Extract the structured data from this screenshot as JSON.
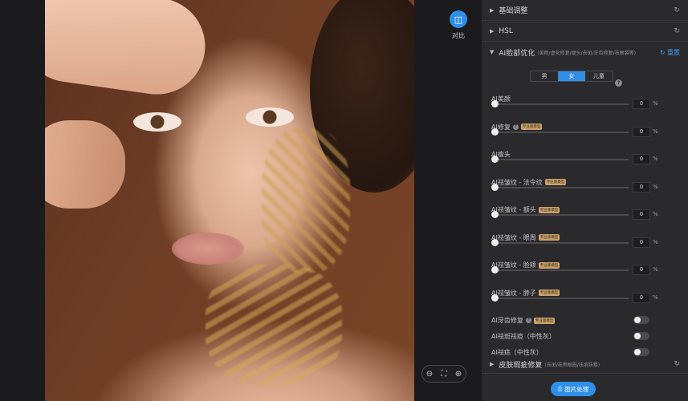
{
  "compare": {
    "label": "对比",
    "icon": "compare-icon"
  },
  "zoom": {
    "out": "zoom-out-icon",
    "fit": "fit-screen-icon",
    "in": "zoom-in-icon"
  },
  "sections": {
    "basic": "基础调整",
    "hsl": "HSL",
    "ai_face": "AI脸部优化",
    "ai_face_sub": "(美颜/虚化修复/瘦头/去斑/牙齿修复/祛眼袋等)",
    "ai_face_reset": "重置",
    "skin": "皮肤瑕疵修复",
    "skin_sub": "(去斑/祛黑眼圈/祛痘肤粗)"
  },
  "gender": {
    "male": "男",
    "female": "女",
    "child": "儿童",
    "help": "?"
  },
  "badge_text": "专业版模型",
  "sliders": [
    {
      "label": "AI美颜",
      "value": "0",
      "pct": "%",
      "badge": false,
      "help": false
    },
    {
      "label": "AI修复",
      "value": "0",
      "pct": "%",
      "badge": true,
      "help": true
    },
    {
      "label": "AI瘦头",
      "value": "0",
      "pct": "%",
      "badge": false,
      "help": false
    },
    {
      "label": "AI祛皱纹 - 法令纹",
      "value": "0",
      "pct": "%",
      "badge": true,
      "help": false
    },
    {
      "label": "AI祛皱纹 - 额头",
      "value": "0",
      "pct": "%",
      "badge": true,
      "help": false
    },
    {
      "label": "AI祛皱纹 - 眼周",
      "value": "0",
      "pct": "%",
      "badge": true,
      "help": false
    },
    {
      "label": "AI祛皱纹 - 脸颊",
      "value": "0",
      "pct": "%",
      "badge": true,
      "help": false
    },
    {
      "label": "AI祛皱纹 - 脖子",
      "value": "0",
      "pct": "%",
      "badge": true,
      "help": false
    }
  ],
  "toggles": [
    {
      "label": "AI牙齿修复",
      "badge": true,
      "help": true,
      "on": false
    },
    {
      "label": "AI祛斑祛痘（中性灰）",
      "badge": false,
      "help": false,
      "on": false
    },
    {
      "label": "AI祛痣（中性灰）",
      "badge": false,
      "help": false,
      "on": false
    }
  ],
  "process_button": "图片处理",
  "colors": {
    "accent": "#2f8fe8",
    "panel": "#2a2a2d",
    "badge": "#c9a26b"
  }
}
